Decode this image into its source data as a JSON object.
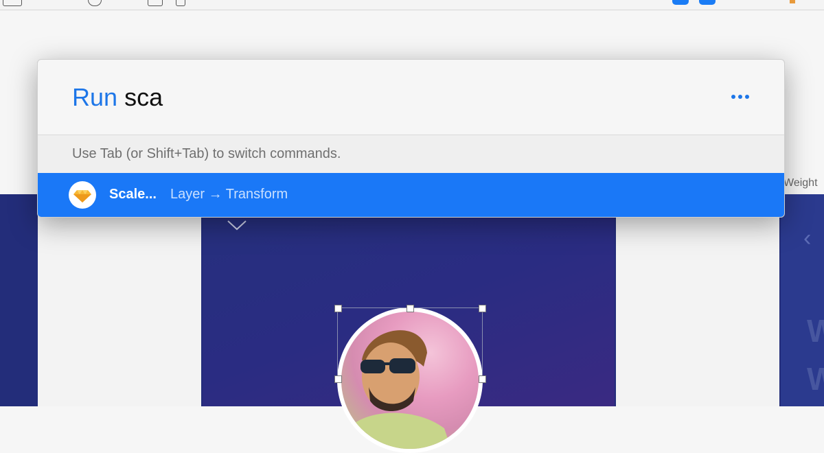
{
  "palette": {
    "keyword": "Run",
    "query": "sca",
    "hint": "Use Tab (or Shift+Tab) to switch commands.",
    "result": {
      "label": "Scale...",
      "path": "Layer → Transform",
      "icon": "sketch-diamond-icon"
    },
    "more_icon": "more-dots-icon"
  },
  "inspector": {
    "weight_label": "Weight"
  },
  "colors": {
    "accent": "#1a78f7",
    "navy": "#232d7a"
  }
}
